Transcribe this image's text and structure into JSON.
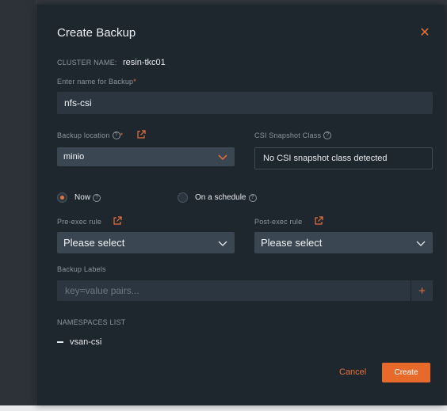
{
  "modal": {
    "title": "Create Backup",
    "close_icon": "close-icon"
  },
  "cluster": {
    "label": "CLUSTER NAME:",
    "value": "resin-tkc01"
  },
  "backup_name": {
    "label": "Enter name for Backup",
    "required_mark": "*",
    "value": "nfs-csi"
  },
  "backup_location": {
    "label": "Backup location",
    "help": "?",
    "required_mark": "*",
    "selected": "minio",
    "link_icon": "external-link-icon"
  },
  "csi_snapshot": {
    "label": "CSI Snapshot Class",
    "help": "?",
    "value": "No CSI snapshot class detected"
  },
  "schedule": {
    "now_label": "Now",
    "now_help": "?",
    "schedule_label": "On a schedule",
    "schedule_help": "?",
    "selected": "Now"
  },
  "pre_exec": {
    "label": "Pre-exec rule",
    "placeholder": "Please select"
  },
  "post_exec": {
    "label": "Post-exec rule",
    "placeholder": "Please select"
  },
  "backup_labels": {
    "label": "Backup Labels",
    "placeholder": "key=value pairs...",
    "add_icon": "plus-icon"
  },
  "namespaces": {
    "label": "NAMESPACES LIST",
    "items": [
      "vsan-csi"
    ]
  },
  "actions": {
    "cancel_label": "Cancel",
    "create_label": "Create"
  },
  "colors": {
    "accent": "#e8703a",
    "modal_bg": "#1f272e",
    "input_bg": "#2c3640"
  }
}
